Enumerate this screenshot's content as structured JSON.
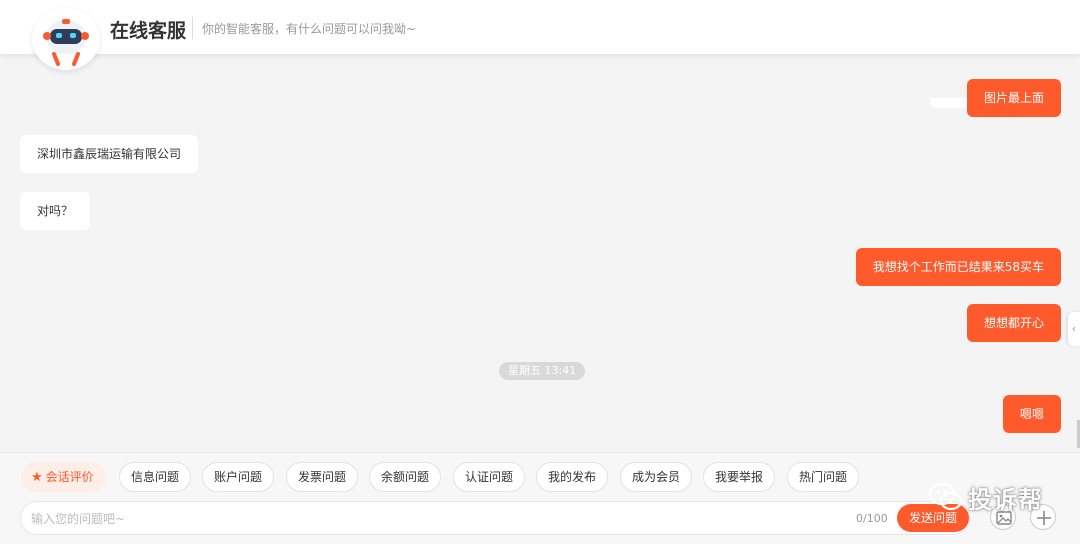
{
  "header": {
    "title": "在线客服",
    "subtitle": "你的智能客服，有什么问题可以问我呦~"
  },
  "messages": [
    {
      "side": "right",
      "text": "图片最上面"
    },
    {
      "side": "left",
      "text": "深圳市鑫辰瑞运输有限公司"
    },
    {
      "side": "left",
      "text": "对吗？"
    },
    {
      "side": "right",
      "text": "我想找个工作而已结果来58买车"
    },
    {
      "side": "right",
      "text": "想想都开心"
    },
    {
      "side": "right",
      "text": "嗯嗯"
    }
  ],
  "timestamp": "星期五 13:41",
  "quick_actions": {
    "rate": "会话评价",
    "items": [
      "信息问题",
      "账户问题",
      "发票问题",
      "余额问题",
      "认证问题",
      "我的发布",
      "成为会员",
      "我要举报",
      "热门问题"
    ]
  },
  "input": {
    "placeholder": "输入您的问题吧~",
    "value": "",
    "counter": "0/100",
    "send_label": "发送问题"
  },
  "watermark": "投诉帮",
  "colors": {
    "accent": "#ff5a2c",
    "background": "#f4f4f4"
  },
  "icons": [
    "robot-avatar-icon",
    "star-icon",
    "image-icon",
    "plus-icon",
    "chevron-left-icon",
    "wechat-icon"
  ]
}
